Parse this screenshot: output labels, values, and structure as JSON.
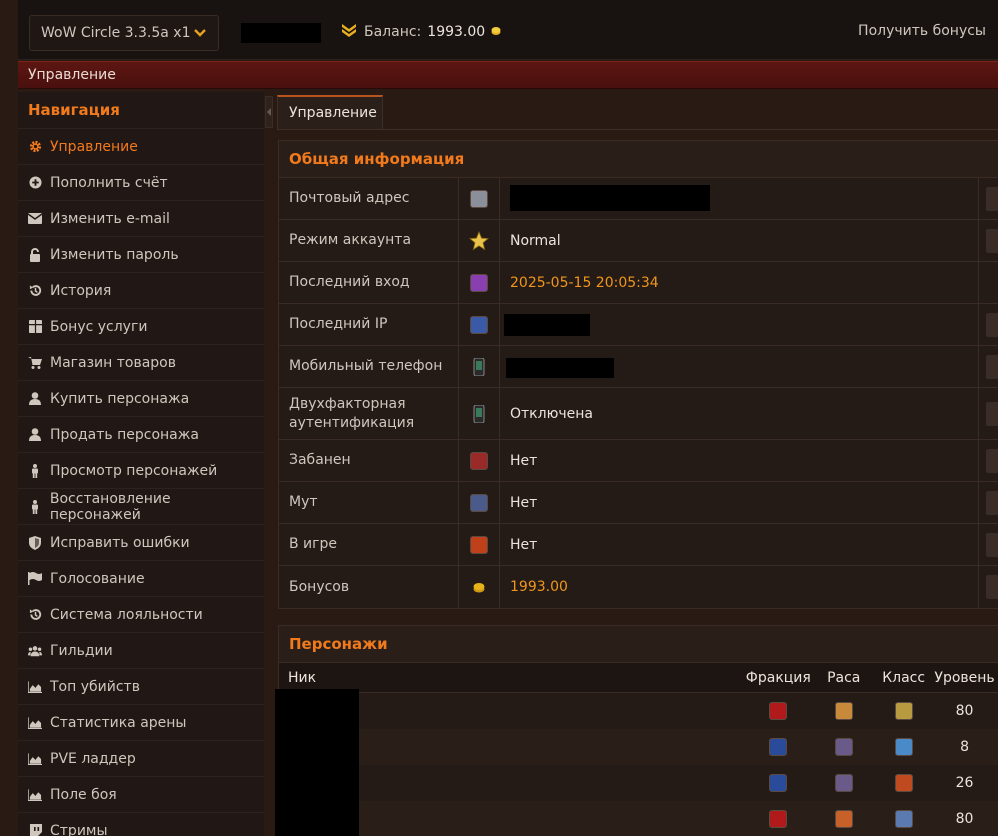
{
  "topbar": {
    "server": "WoW Circle 3.3.5a x1",
    "balance_label": "Баланс:",
    "balance_value": "1993.00",
    "get_bonus": "Получить бонусы"
  },
  "section_title": "Управление",
  "nav": {
    "title": "Навигация",
    "items": [
      {
        "label": "Управление",
        "icon": "gear-icon"
      },
      {
        "label": "Пополнить счёт",
        "icon": "plus-circle-icon"
      },
      {
        "label": "Изменить e-mail",
        "icon": "envelope-icon"
      },
      {
        "label": "Изменить пароль",
        "icon": "unlock-icon"
      },
      {
        "label": "История",
        "icon": "history-icon"
      },
      {
        "label": "Бонус услуги",
        "icon": "gift-icon"
      },
      {
        "label": "Магазин товаров",
        "icon": "cart-icon"
      },
      {
        "label": "Купить персонажа",
        "icon": "user-icon"
      },
      {
        "label": "Продать персонажа",
        "icon": "user-icon"
      },
      {
        "label": "Просмотр персонажей",
        "icon": "person-icon"
      },
      {
        "label": "Восстановление персонажей",
        "icon": "person-icon"
      },
      {
        "label": "Исправить ошибки",
        "icon": "shield-icon"
      },
      {
        "label": "Голосование",
        "icon": "flag-icon"
      },
      {
        "label": "Система лояльности",
        "icon": "history-icon"
      },
      {
        "label": "Гильдии",
        "icon": "users-icon"
      },
      {
        "label": "Топ убийств",
        "icon": "area-chart-icon"
      },
      {
        "label": "Статистика арены",
        "icon": "area-chart-icon"
      },
      {
        "label": "PVE ладдер",
        "icon": "area-chart-icon"
      },
      {
        "label": "Поле боя",
        "icon": "area-chart-icon"
      },
      {
        "label": "Стримы",
        "icon": "twitch-icon"
      }
    ]
  },
  "tab_label": "Управление",
  "info": {
    "title": "Общая информация",
    "rows": [
      {
        "label": "Почтовый адрес",
        "value": "",
        "icon": "mail-icon",
        "color": "#8a8f9a"
      },
      {
        "label": "Режим аккаунта",
        "value": "Normal",
        "icon": "star-icon",
        "color": "#e8c24a"
      },
      {
        "label": "Последний вход",
        "value": "2025-05-15 20:05:34",
        "icon": "portal-icon",
        "color": "#8a3fb0"
      },
      {
        "label": "Последний IP",
        "value": "",
        "icon": "network-icon",
        "color": "#3a5aa8"
      },
      {
        "label": "Мобильный телефон",
        "value": "",
        "icon": "phone-icon",
        "color": "#3a7a5a"
      },
      {
        "label": "Двухфакторная аутентификация",
        "value": "Отключена",
        "icon": "phone-icon",
        "color": "#3a7a5a"
      },
      {
        "label": "Забанен",
        "value": "Нет",
        "icon": "ban-icon",
        "color": "#9a2a2a"
      },
      {
        "label": "Мут",
        "value": "Нет",
        "icon": "mute-icon",
        "color": "#4a5a8a"
      },
      {
        "label": "В игре",
        "value": "Нет",
        "icon": "ingame-icon",
        "color": "#c0401a"
      },
      {
        "label": "Бонусов",
        "value": "1993.00",
        "icon": "coin-icon",
        "color": "#e8b21a"
      }
    ]
  },
  "chars": {
    "title": "Персонажи",
    "headers": {
      "nick": "Ник",
      "faction": "Фракция",
      "race": "Раса",
      "class": "Класс",
      "level": "Уровень"
    },
    "rows": [
      {
        "faction": "horde",
        "level": "80"
      },
      {
        "faction": "alliance",
        "level": "8"
      },
      {
        "faction": "alliance",
        "level": "26"
      },
      {
        "faction": "horde",
        "level": "80"
      }
    ],
    "colors": {
      "horde": "#b01a1a",
      "alliance": "#2a4a9a"
    }
  }
}
